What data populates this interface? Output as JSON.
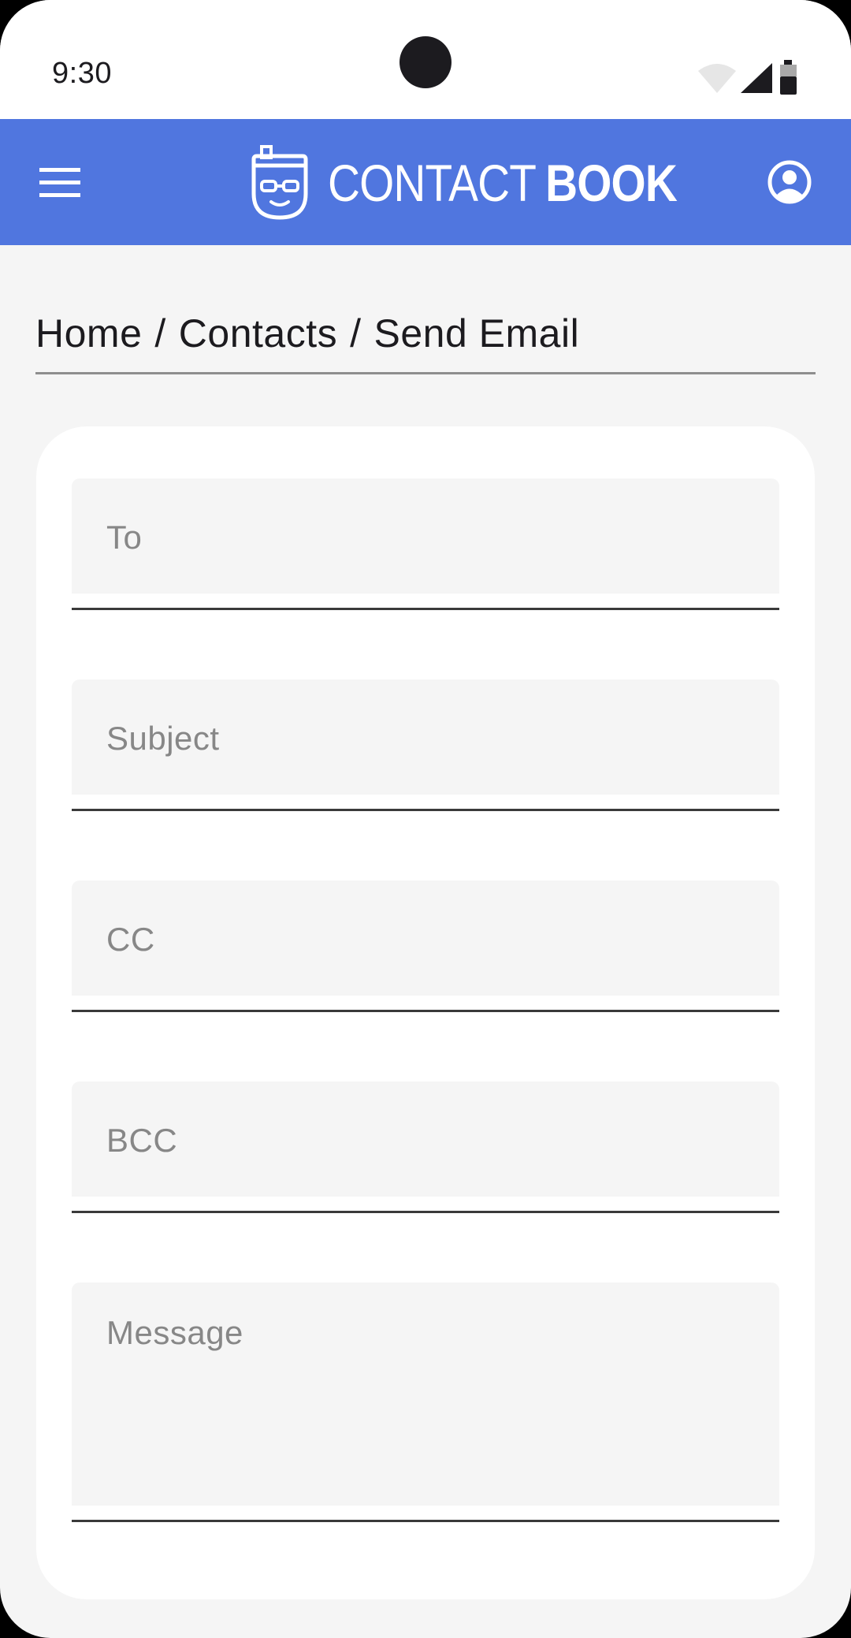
{
  "status_bar": {
    "time": "9:30"
  },
  "app_bar": {
    "logo_light": "CONTACT",
    "logo_bold": "BOOK",
    "menu_icon": "hamburger-menu-icon",
    "account_icon": "account-circle-icon"
  },
  "breadcrumb": {
    "items": [
      "Home",
      "Contacts",
      "Send Email"
    ],
    "separator": "/"
  },
  "form": {
    "fields": [
      {
        "name": "to",
        "placeholder": "To",
        "value": ""
      },
      {
        "name": "subject",
        "placeholder": "Subject",
        "value": ""
      },
      {
        "name": "cc",
        "placeholder": "CC",
        "value": ""
      },
      {
        "name": "bcc",
        "placeholder": "BCC",
        "value": ""
      },
      {
        "name": "message",
        "placeholder": "Message",
        "value": ""
      }
    ]
  },
  "colors": {
    "app_bar": "#5076df",
    "background": "#f5f5f5",
    "card": "#ffffff",
    "field_fill": "#f5f5f5",
    "placeholder": "#878787",
    "text": "#1c1b1f"
  }
}
